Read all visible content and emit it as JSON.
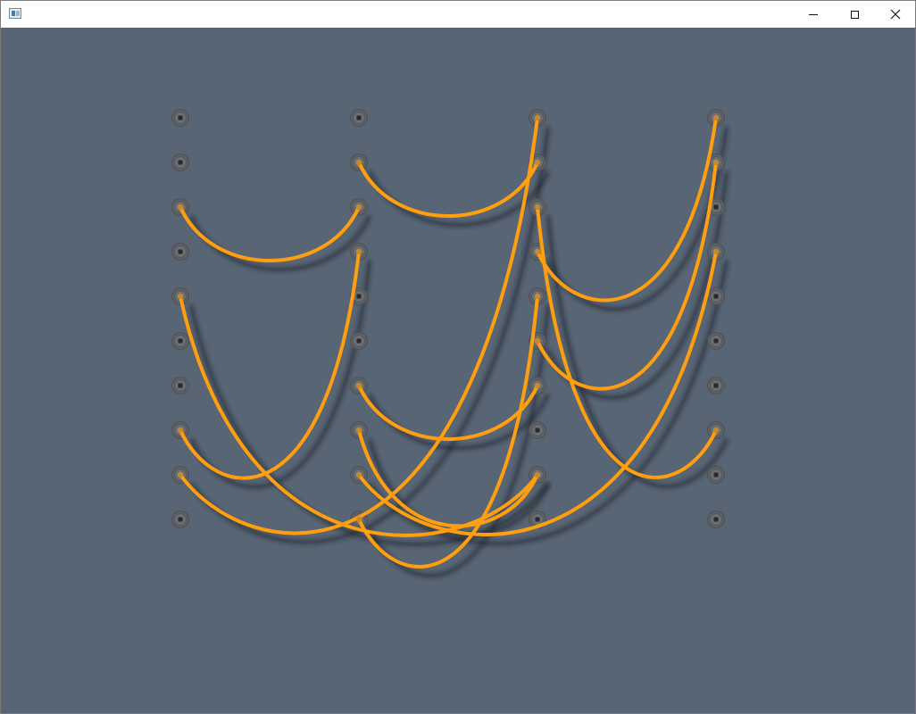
{
  "window": {
    "app_icon": "app-window-icon",
    "controls": [
      {
        "name": "minimize-button",
        "icon": "minimize-icon"
      },
      {
        "name": "maximize-button",
        "icon": "maximize-icon"
      },
      {
        "name": "close-button",
        "icon": "close-icon"
      }
    ]
  },
  "colors": {
    "canvas_bg": "#576574",
    "wire": "#ff9f10",
    "wire_shadow": "#1e2328",
    "port_ring": "#6b6f73",
    "port_core": "#2a2a2a"
  },
  "ports": {
    "columns": 4,
    "rows": 10
  },
  "connections": [
    {
      "from": [
        0,
        2
      ],
      "to": [
        1,
        2
      ]
    },
    {
      "from": [
        1,
        1
      ],
      "to": [
        2,
        1
      ]
    },
    {
      "from": [
        0,
        4
      ],
      "to": [
        2,
        8
      ]
    },
    {
      "from": [
        0,
        7
      ],
      "to": [
        1,
        3
      ]
    },
    {
      "from": [
        0,
        8
      ],
      "to": [
        2,
        0
      ]
    },
    {
      "from": [
        1,
        6
      ],
      "to": [
        2,
        6
      ]
    },
    {
      "from": [
        1,
        7
      ],
      "to": [
        2,
        8
      ]
    },
    {
      "from": [
        1,
        9
      ],
      "to": [
        2,
        4
      ]
    },
    {
      "from": [
        1,
        8
      ],
      "to": [
        3,
        3
      ]
    },
    {
      "from": [
        2,
        2
      ],
      "to": [
        3,
        7
      ]
    },
    {
      "from": [
        2,
        3
      ],
      "to": [
        3,
        0
      ]
    },
    {
      "from": [
        2,
        5
      ],
      "to": [
        3,
        1
      ]
    }
  ]
}
